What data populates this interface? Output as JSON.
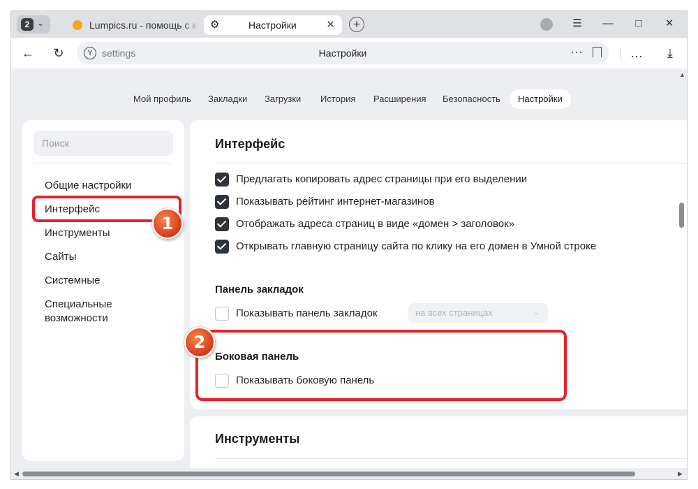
{
  "browser": {
    "tab_count": "2",
    "tabs": [
      {
        "title": "Lumpics.ru - помощь с ко"
      },
      {
        "title": "Настройки"
      }
    ],
    "address": {
      "url": "settings",
      "page_title": "Настройки"
    }
  },
  "topnav": {
    "items": [
      "Мой профиль",
      "Закладки",
      "Загрузки",
      "История",
      "Расширения",
      "Безопасность",
      "Настройки"
    ],
    "active": "Настройки"
  },
  "sidebar": {
    "search_placeholder": "Поиск",
    "items": [
      "Общие настройки",
      "Интерфейс",
      "Инструменты",
      "Сайты",
      "Системные",
      "Специальные возможности"
    ],
    "selected": "Интерфейс"
  },
  "interface": {
    "title": "Интерфейс",
    "options": [
      {
        "label": "Предлагать копировать адрес страницы при его выделении",
        "checked": true
      },
      {
        "label": "Показывать рейтинг интернет-магазинов",
        "checked": true
      },
      {
        "label": "Отображать адреса страниц в виде «домен > заголовок»",
        "checked": true
      },
      {
        "label": "Открывать главную страницу сайта по клику на его домен в Умной строке",
        "checked": true
      }
    ],
    "bookmarks_bar": {
      "title": "Панель закладок",
      "option": {
        "label": "Показывать панель закладок",
        "checked": false
      },
      "select_value": "на всех страницах"
    },
    "side_panel": {
      "title": "Боковая панель",
      "option": {
        "label": "Показывать боковую панель",
        "checked": false
      }
    }
  },
  "tools": {
    "title": "Инструменты"
  },
  "annotations": {
    "badge1": "1",
    "badge2": "2",
    "color": "#e8212b"
  }
}
